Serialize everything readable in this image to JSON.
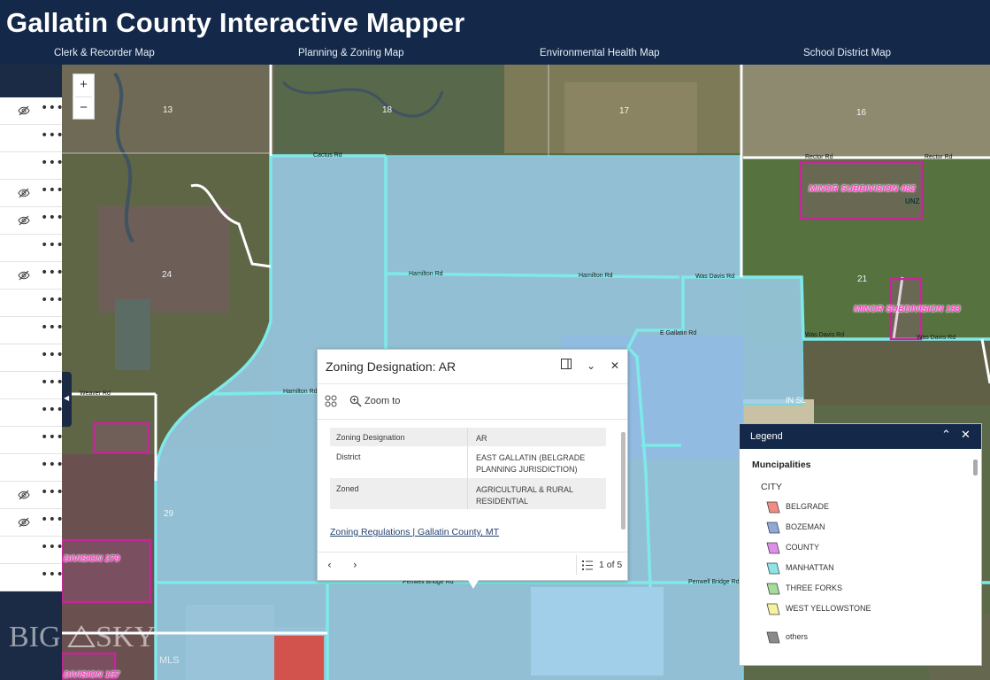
{
  "app": {
    "title": "Gallatin County Interactive Mapper"
  },
  "nav": {
    "tabs": [
      {
        "label": "Clerk & Recorder Map"
      },
      {
        "label": "Planning & Zoning Map"
      },
      {
        "label": "Environmental Health Map"
      },
      {
        "label": "School District Map"
      }
    ]
  },
  "layer_list": {
    "more_glyph": "•••",
    "rows": [
      {
        "hidden": true
      },
      {
        "hidden": false
      },
      {
        "hidden": false
      },
      {
        "hidden": true
      },
      {
        "hidden": true
      },
      {
        "hidden": false
      },
      {
        "hidden": true
      },
      {
        "hidden": false
      },
      {
        "hidden": false
      },
      {
        "hidden": false
      },
      {
        "hidden": false
      },
      {
        "hidden": false
      },
      {
        "hidden": false
      },
      {
        "hidden": false
      },
      {
        "hidden": true
      },
      {
        "hidden": true
      },
      {
        "hidden": false
      },
      {
        "hidden": false
      }
    ]
  },
  "zoom": {
    "in_label": "+",
    "out_label": "−"
  },
  "map": {
    "section_numbers": [
      "13",
      "18",
      "17",
      "16",
      "24",
      "21",
      "29"
    ],
    "subdivision_labels": [
      "MINOR SUBDIVISION 482",
      "MINOR SUBDIVISION 193",
      "DIVISION 279",
      "DIVISION 157"
    ],
    "road_labels": [
      "Cactus Rd",
      "Hamilton Rd",
      "Hamilton Rd",
      "Hamilton Rd",
      "Was Davis Rd",
      "Rector Rd",
      "Rector Rd",
      "Weaver Rd",
      "Penwell Bridge Rd",
      "Penwell Bridge Rd",
      "E Gallatin Rd",
      "Was Davis Rd",
      "Was Davis Rd"
    ],
    "misc_labels": [
      "UNZ",
      "IN SL"
    ]
  },
  "popup": {
    "title": "Zoning Designation: AR",
    "dock_icon": "dock-icon",
    "collapse_glyph": "⌄",
    "close_glyph": "✕",
    "zoom_to_label": "Zoom to",
    "attributes": [
      {
        "key": "Zoning Designation",
        "value": "AR"
      },
      {
        "key": "District",
        "value": "EAST GALLATIN (BELGRADE PLANNING JURISDICTION)"
      },
      {
        "key": "Zoned",
        "value": "AGRICULTURAL & RURAL RESIDENTIAL"
      }
    ],
    "link_text": "Zoning Regulations | Gallatin County, MT",
    "prev_glyph": "‹",
    "next_glyph": "›",
    "feature_count": "1 of 5"
  },
  "legend": {
    "title": "Legend",
    "collapse_glyph": "⌃",
    "close_glyph": "✕",
    "layer_title": "Muncipalities",
    "field_label": "CITY",
    "items": [
      {
        "label": "BELGRADE",
        "color": "#f28b85"
      },
      {
        "label": "BOZEMAN",
        "color": "#8ea9d8"
      },
      {
        "label": "COUNTY",
        "color": "#dc8ee8"
      },
      {
        "label": "MANHATTAN",
        "color": "#8ae6e6"
      },
      {
        "label": "THREE FORKS",
        "color": "#a4dc9a"
      },
      {
        "label": "WEST YELLOWSTONE",
        "color": "#f7f29c"
      },
      {
        "label": "others",
        "color": "#8a8a8a"
      }
    ]
  },
  "watermark": {
    "text_big": "BIG",
    "text_sky": "SKY",
    "text_mls": "MLS"
  },
  "colors": {
    "header_bg": "#14294a",
    "zone_fill": "#9fd2f2",
    "road_cyan": "#7fe9e9",
    "subdivision_magenta": "#d02ea4"
  }
}
